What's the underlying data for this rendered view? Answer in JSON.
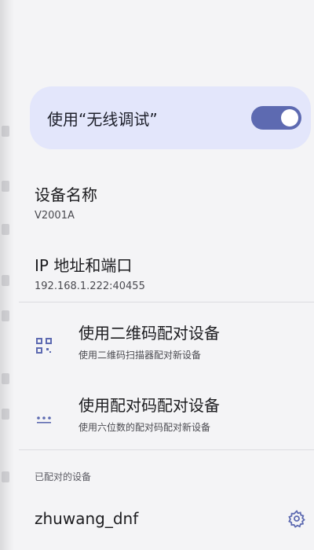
{
  "wireless_debug": {
    "label": "使用“无线调试”",
    "enabled": true,
    "accent_color": "#5d6ab1"
  },
  "device_name": {
    "title": "设备名称",
    "value": "V2001A"
  },
  "ip_port": {
    "title": "IP 地址和端口",
    "value": "192.168.1.222:40455"
  },
  "pair_qr": {
    "title": "使用二维码配对设备",
    "subtitle": "使用二维码扫描器配对新设备",
    "icon": "qr-code-icon"
  },
  "pair_code": {
    "title": "使用配对码配对设备",
    "subtitle": "使用六位数的配对码配对新设备",
    "icon": "dots-icon"
  },
  "paired_devices": {
    "section_title": "已配对的设备",
    "items": [
      {
        "name": "zhuwang_dnf",
        "icon": "gear-icon"
      }
    ]
  }
}
